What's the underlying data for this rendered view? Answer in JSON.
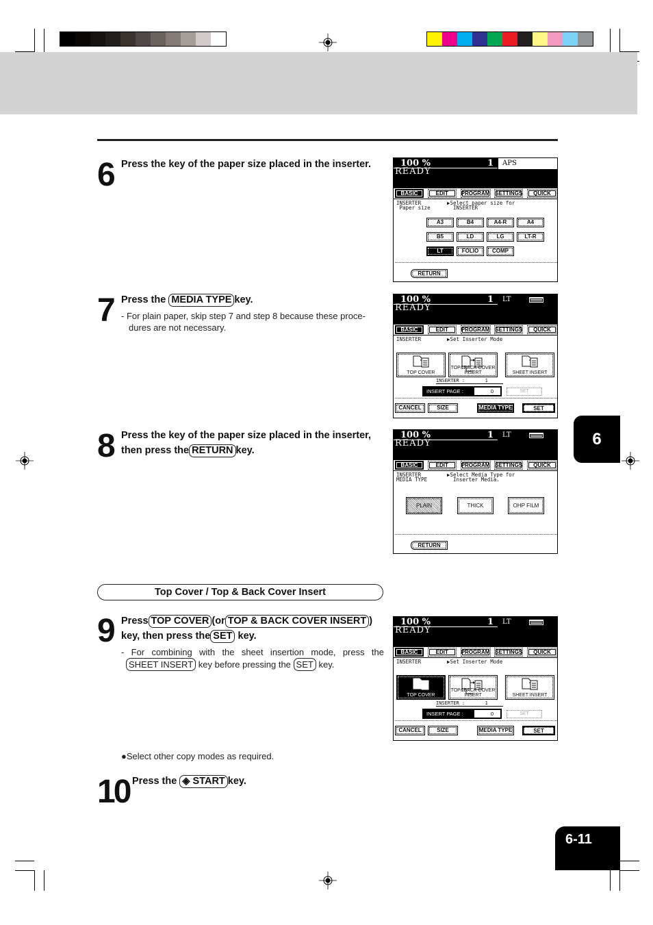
{
  "print_marks": {
    "grayscale_swatches": [
      "#000000",
      "#0a0806",
      "#151210",
      "#231f1c",
      "#3a3330",
      "#504846",
      "#6a625e",
      "#857b77",
      "#a59d9a",
      "#d3cbc9",
      "#ffffff"
    ],
    "color_swatches": [
      "#fff200",
      "#ec008c",
      "#00aeef",
      "#2e3192",
      "#00a651",
      "#ed1c24",
      "#231f20",
      "#fff685",
      "#f49ac1",
      "#7dd3f7",
      "#939598"
    ]
  },
  "chapter_tab": "6",
  "page_number": "6-11",
  "section_title": "Top Cover / Top & Back Cover Insert",
  "steps": [
    {
      "number": "6",
      "title": "Press the key of the paper size placed in the inserter."
    },
    {
      "number": "7",
      "title_pre": "Press the",
      "key": "MEDIA TYPE",
      "title_post": "key.",
      "note_line1": "- For plain paper, skip step 7 and step 8 because these proce-",
      "note_line2": "dures are not necessary."
    },
    {
      "number": "8",
      "title_line1": "Press the key of the paper size placed in the inserter,",
      "title_pre": "then press the",
      "key": "RETURN",
      "title_post": "key."
    },
    {
      "number": "9",
      "title_pre": "Press",
      "key1": "TOP COVER",
      "mid": "(or",
      "key2": "TOP & BACK COVER  INSERT",
      "close": ")",
      "line2_pre": "key, then press the",
      "key3": "SET",
      "line2_post": "key.",
      "note_line1": "- For combining with the sheet insertion mode, press the",
      "note_key1": "SHEET INSERT",
      "note_mid": "key before pressing the",
      "note_key2": "SET",
      "note_post": "key."
    },
    {
      "bullet": "Select other copy modes as required."
    },
    {
      "number": "10",
      "title_pre": "Press the",
      "key_icon": "start-diamond-icon",
      "key": "START",
      "title_post": "key."
    }
  ],
  "lcd_common": {
    "zoom": "100  %",
    "count": "1",
    "status": "READY",
    "tabs": [
      "BASIC",
      "EDIT",
      "PROGRAM",
      "SETTINGS",
      "QUICK"
    ],
    "active_tab": "BASIC"
  },
  "lcd1": {
    "paper": "APS",
    "left_label": "INSERTER\n Paper size",
    "right_label": "▶Select paper size for\n  INSERTER",
    "sizes": [
      "A3",
      "B4",
      "A4-R",
      "A4",
      "B5",
      "LD",
      "LG",
      "LT-R",
      "LT",
      "FOLIO",
      "COMP"
    ],
    "selected_size": "LT",
    "return_label": "RETURN"
  },
  "lcd2": {
    "paper": "LT",
    "left_label": "INSERTER",
    "right_label": "▶Set Inserter Mode",
    "modes": [
      "TOP COVER",
      "TOP&BACK COVER INSERT",
      "SHEET INSERT"
    ],
    "selected_mode": "",
    "inserter_line": "INSERTER :       1",
    "insert_page_label": "INSERT PAGE :",
    "insert_page_value": "0",
    "set_dim": "SET",
    "bottom_buttons": [
      "CANCEL",
      "SIZE",
      "MEDIA TYPE",
      "SET"
    ],
    "highlighted_bottom": "MEDIA TYPE"
  },
  "lcd3": {
    "paper": "LT",
    "left_label": "INSERTER\nMEDIA TYPE",
    "right_label": "▶Select Media Type for\n  Inserter Media.",
    "media": [
      "PLAIN",
      "THICK",
      "OHP FILM"
    ],
    "selected_media": "PLAIN",
    "return_label": "RETURN"
  },
  "lcd4": {
    "paper": "LT",
    "left_label": "INSERTER",
    "right_label": "▶Set Inserter Mode",
    "modes": [
      "TOP COVER",
      "TOP&BACK COVER INSERT",
      "SHEET INSERT"
    ],
    "selected_mode": "TOP COVER",
    "inserter_line": "INSERTER :       1",
    "insert_page_label": "INSERT PAGE :",
    "insert_page_value": "0",
    "set_dim": "SET",
    "bottom_buttons": [
      "CANCEL",
      "SIZE",
      "MEDIA TYPE",
      "SET"
    ],
    "highlighted_bottom": ""
  }
}
